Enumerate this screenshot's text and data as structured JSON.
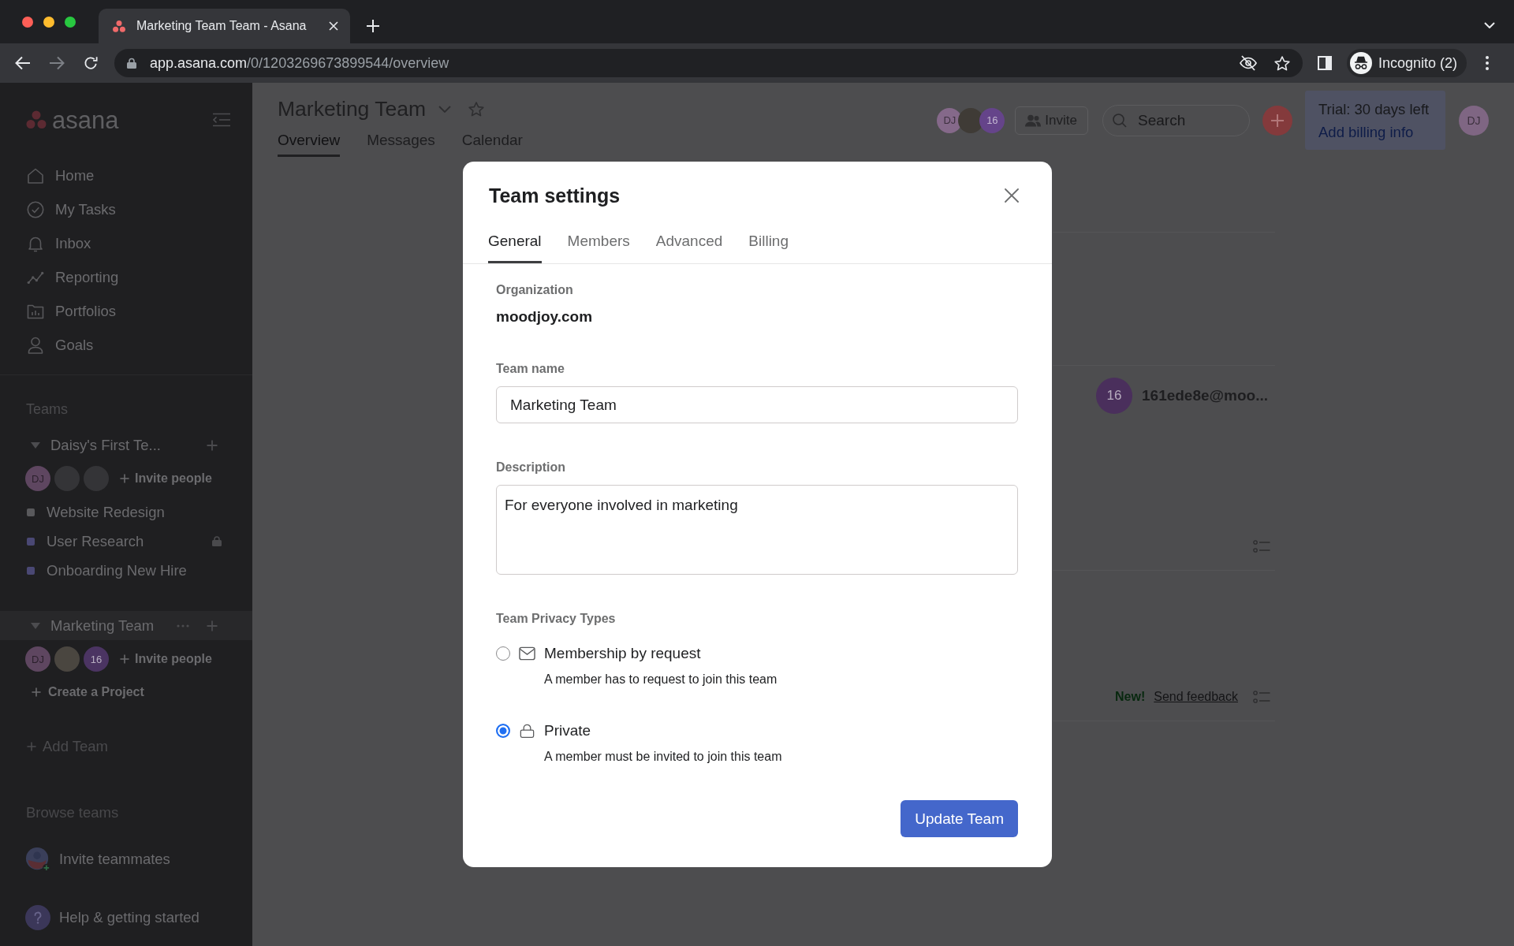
{
  "browser": {
    "tabs": [
      {
        "title": "Marketing Team Team - Asana",
        "selected": true
      }
    ],
    "url": {
      "host": "app.asana.com",
      "path": "/0/1203269673899544/overview"
    },
    "profile": "Incognito (2)"
  },
  "sidebar": {
    "logo": "asana",
    "nav": [
      {
        "label": "Home"
      },
      {
        "label": "My Tasks"
      },
      {
        "label": "Inbox"
      },
      {
        "label": "Reporting"
      },
      {
        "label": "Portfolios"
      },
      {
        "label": "Goals"
      }
    ],
    "teams_heading": "Teams",
    "teams": [
      {
        "name": "Daisy's First Te...",
        "expanded": true,
        "selected": false,
        "members": [
          {
            "kind": "initials",
            "initials": "DJ",
            "color": "#5e4660"
          },
          {
            "kind": "blank"
          },
          {
            "kind": "blank"
          }
        ],
        "invite": "Invite people",
        "projects": [
          {
            "name": "Website Redesign",
            "color": "#59595c",
            "locked": false
          },
          {
            "name": "User Research",
            "color": "#4a4874",
            "locked": true
          },
          {
            "name": "Onboarding New Hire",
            "color": "#4a4874",
            "locked": false
          }
        ]
      },
      {
        "name": "Marketing Team",
        "expanded": true,
        "selected": true,
        "members": [
          {
            "kind": "initials",
            "initials": "DJ",
            "color": "#5e4660"
          },
          {
            "kind": "photo"
          },
          {
            "kind": "initials",
            "initials": "16",
            "color": "#4b3462"
          }
        ],
        "invite": "Invite people",
        "create_project": "Create a Project"
      }
    ],
    "add_team": "Add Team",
    "browse_teams": "Browse teams",
    "invite_teammates": "Invite teammates",
    "help": "Help & getting started"
  },
  "header": {
    "title": "Marketing Team",
    "tabs": [
      {
        "label": "Overview",
        "selected": true
      },
      {
        "label": "Messages",
        "selected": false
      },
      {
        "label": "Calendar",
        "selected": false
      }
    ],
    "members": [
      {
        "kind": "initials",
        "initials": "DJ",
        "color": "#85698a"
      },
      {
        "kind": "photo"
      },
      {
        "kind": "initials",
        "initials": "16",
        "color": "#65448a"
      }
    ],
    "invite": "Invite",
    "search": {
      "placeholder": "Search"
    },
    "trial": {
      "text": "Trial: 30 days left",
      "link": "Add billing info"
    },
    "user": {
      "initials": "DJ",
      "color": "#7f6683"
    }
  },
  "background": {
    "member": {
      "initials": "16",
      "color": "#4a2f5c",
      "email": "161ede8e@moo..."
    },
    "new_badge": "New!",
    "feedback": "Send feedback"
  },
  "dialog": {
    "title": "Team settings",
    "tabs": [
      {
        "label": "General",
        "selected": true
      },
      {
        "label": "Members",
        "selected": false
      },
      {
        "label": "Advanced",
        "selected": false
      },
      {
        "label": "Billing",
        "selected": false
      }
    ],
    "organization": {
      "label": "Organization",
      "value": "moodjoy.com"
    },
    "team_name": {
      "label": "Team name",
      "value": "Marketing Team"
    },
    "description": {
      "label": "Description",
      "value": "For everyone involved in marketing"
    },
    "privacy": {
      "label": "Team Privacy Types",
      "options": [
        {
          "title": "Membership by request",
          "description": "A member has to request to join this team",
          "selected": false
        },
        {
          "title": "Private",
          "description": "A member must be invited to join this team",
          "selected": true
        }
      ]
    },
    "submit": "Update Team"
  }
}
